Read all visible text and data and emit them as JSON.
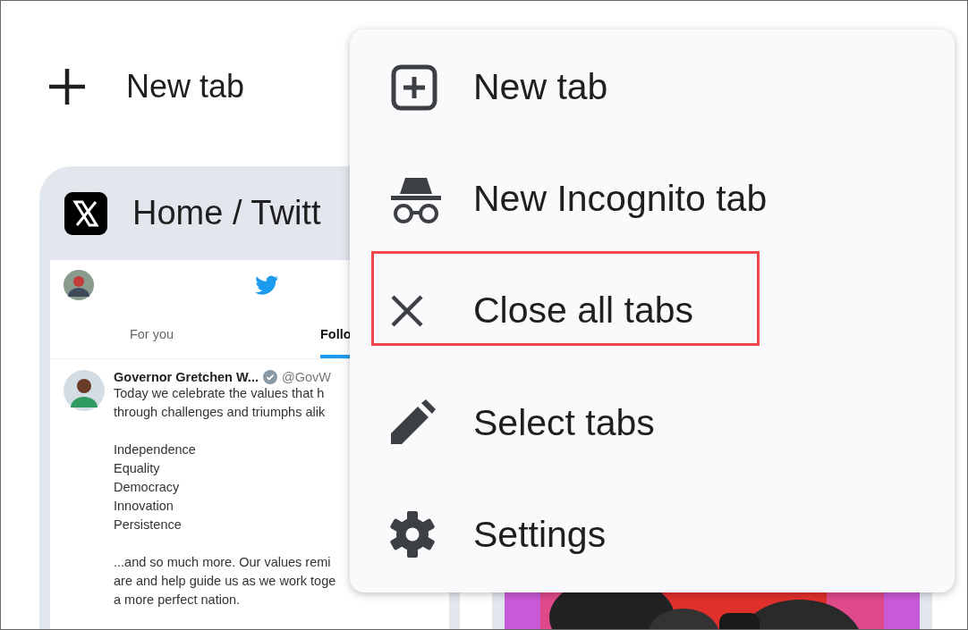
{
  "header": {
    "new_tab_label": "New tab"
  },
  "tab_cards": [
    {
      "kind": "page",
      "title": "Home / Twitt",
      "thumbnail": {
        "tabs": [
          {
            "label": "For you",
            "selected": false
          },
          {
            "label": "Follo",
            "selected": true
          }
        ],
        "tweet": {
          "author": "Governor Gretchen W...",
          "handle": "@GovW",
          "paragraphs": [
            [
              "Today we celebrate the values that h",
              "through challenges and triumphs alik"
            ],
            [
              "Independence",
              "Equality",
              "Democracy",
              "Innovation",
              "Persistence"
            ],
            [
              "...and so much more. Our values remi",
              "are and help guide us as we work toge",
              "a more perfect nation."
            ]
          ]
        }
      }
    },
    {
      "kind": "picture"
    }
  ],
  "menu": {
    "items": [
      {
        "kind": "new-tab",
        "label": "New tab",
        "highlighted": false
      },
      {
        "kind": "incognito",
        "label": "New Incognito tab",
        "highlighted": false
      },
      {
        "kind": "close",
        "label": "Close all tabs",
        "highlighted": true
      },
      {
        "kind": "select",
        "label": "Select tabs",
        "highlighted": false
      },
      {
        "kind": "settings",
        "label": "Settings",
        "highlighted": false
      }
    ]
  }
}
